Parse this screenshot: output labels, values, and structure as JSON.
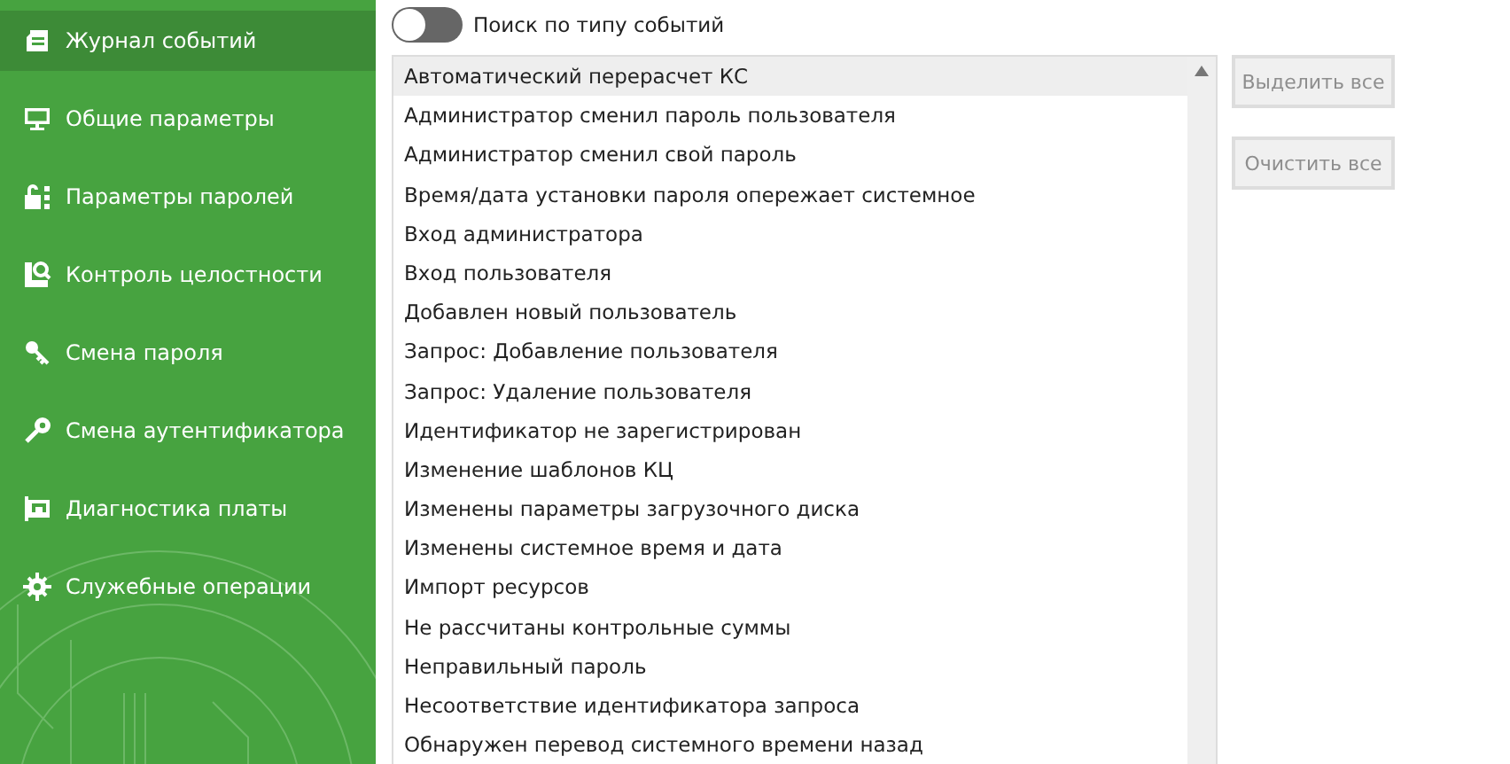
{
  "sidebar": {
    "items": [
      {
        "label": "Журнал событий",
        "kind": "log",
        "selected": true
      },
      {
        "label": "Общие параметры",
        "kind": "monitor",
        "selected": false
      },
      {
        "label": "Параметры паролей",
        "kind": "lock",
        "selected": false
      },
      {
        "label": "Контроль целостности",
        "kind": "check",
        "selected": false
      },
      {
        "label": "Смена пароля",
        "kind": "keys",
        "selected": false
      },
      {
        "label": "Смена аутентификатора",
        "kind": "key",
        "selected": false
      },
      {
        "label": "Диагностика платы",
        "kind": "board",
        "selected": false
      },
      {
        "label": "Служебные операции",
        "kind": "gear",
        "selected": false
      }
    ]
  },
  "search_toggle": {
    "label": "Поиск по типу событий",
    "on": false
  },
  "event_types": [
    {
      "label": "Автоматический перерасчет КС",
      "selected": true
    },
    {
      "label": "Администратор сменил пароль пользователя",
      "selected": false
    },
    {
      "label": "Администратор сменил свой пароль",
      "selected": false
    },
    {
      "label": "Время/дата установки пароля опережает системное",
      "selected": false
    },
    {
      "label": "Вход администратора",
      "selected": false
    },
    {
      "label": "Вход пользователя",
      "selected": false
    },
    {
      "label": "Добавлен новый пользователь",
      "selected": false
    },
    {
      "label": "Запрос: Добавление пользователя",
      "selected": false
    },
    {
      "label": "Запрос: Удаление пользователя",
      "selected": false
    },
    {
      "label": "Идентификатор не зарегистрирован",
      "selected": false
    },
    {
      "label": "Изменение шаблонов КЦ",
      "selected": false
    },
    {
      "label": "Изменены параметры загрузочного диска",
      "selected": false
    },
    {
      "label": "Изменены системное время и дата",
      "selected": false
    },
    {
      "label": "Импорт ресурсов",
      "selected": false
    },
    {
      "label": "Не рассчитаны контрольные суммы",
      "selected": false
    },
    {
      "label": "Неправильный пароль",
      "selected": false
    },
    {
      "label": "Несоответствие идентификатора запроса",
      "selected": false
    },
    {
      "label": "Обнаружен перевод системного времени назад",
      "selected": false
    }
  ],
  "buttons": [
    {
      "label": "Выделить все",
      "disabled": true
    },
    {
      "label": "Очистить все",
      "disabled": true
    }
  ]
}
